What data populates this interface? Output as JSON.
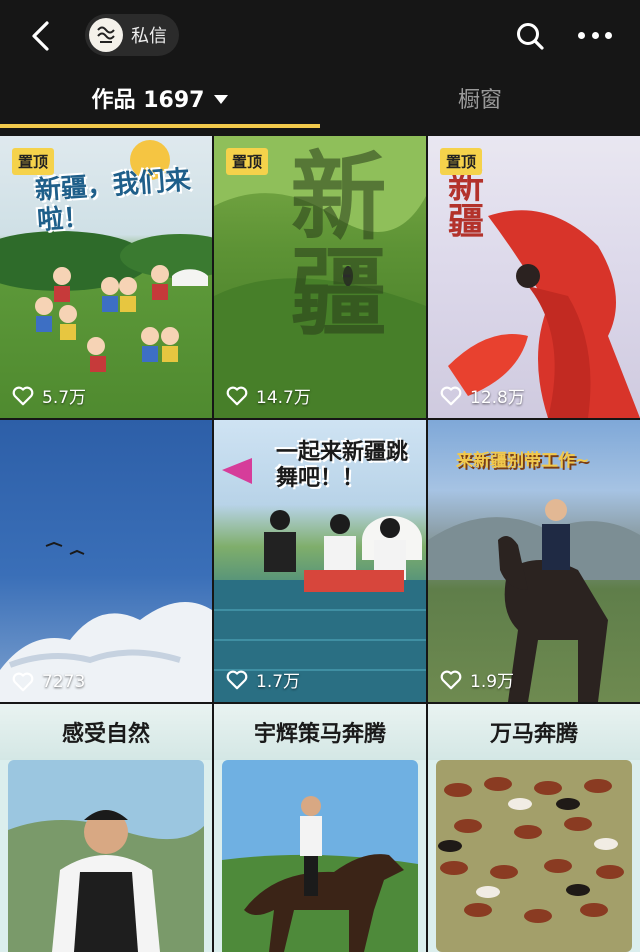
{
  "header": {
    "back_icon": "chevron-left-icon",
    "chip_label": "私信",
    "search_icon": "search-icon",
    "more_icon": "more-horizontal-icon"
  },
  "tabs": {
    "works_label": "作品 1697",
    "shop_label": "橱窗"
  },
  "colors": {
    "accent": "#f2c94c",
    "background": "#161616"
  },
  "videos": [
    {
      "pinned": "置顶",
      "title_text": "新疆，我们来啦！",
      "likes": "5.7万"
    },
    {
      "pinned": "置顶",
      "title_text": "新疆",
      "likes": "14.7万"
    },
    {
      "pinned": "置顶",
      "title_text": "新疆",
      "likes": "12.8万"
    },
    {
      "likes": "7273"
    },
    {
      "title_text": "一起来新疆跳舞吧！！",
      "likes": "1.7万"
    },
    {
      "title_text": "来新疆别带工作~",
      "likes": "1.9万"
    },
    {
      "title_text": "感受自然"
    },
    {
      "title_text": "宇辉策马奔腾"
    },
    {
      "title_text": "万马奔腾"
    }
  ]
}
